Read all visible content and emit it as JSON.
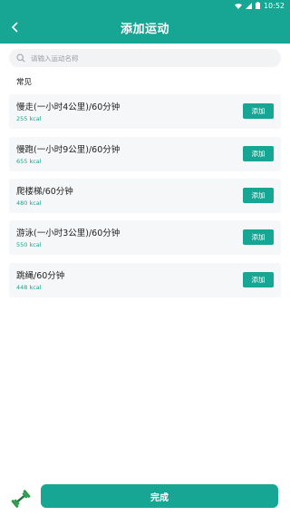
{
  "status_bar": {
    "time": "10:52",
    "icons": [
      "wifi-icon",
      "signal-icon",
      "battery-icon"
    ]
  },
  "header": {
    "title": "添加运动",
    "back_icon": "chevron-left-icon"
  },
  "search": {
    "placeholder": "请输入运动名称",
    "icon": "search-icon"
  },
  "section": {
    "label": "常见"
  },
  "exercises": [
    {
      "name": "慢走(一小时4公里)/60分钟",
      "kcal": "255 kcal",
      "add_label": "添加"
    },
    {
      "name": "慢跑(一小时9公里)/60分钟",
      "kcal": "655 kcal",
      "add_label": "添加"
    },
    {
      "name": "爬楼梯/60分钟",
      "kcal": "480 kcal",
      "add_label": "添加"
    },
    {
      "name": "游泳(一小时3公里)/60分钟",
      "kcal": "550 kcal",
      "add_label": "添加"
    },
    {
      "name": "跳绳/60分钟",
      "kcal": "448 kcal",
      "add_label": "添加"
    }
  ],
  "footer": {
    "done_label": "完成",
    "icon": "dumbbell-icon"
  },
  "colors": {
    "accent": "#17a594",
    "card_bg": "#f6f7f9",
    "search_bg": "#f2f3f5"
  }
}
